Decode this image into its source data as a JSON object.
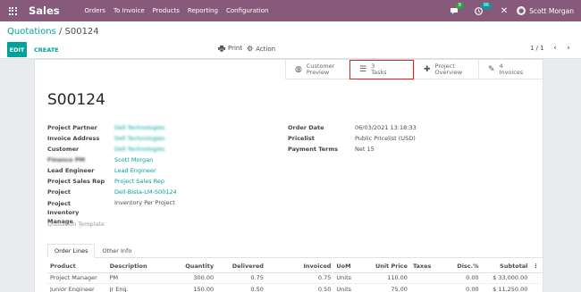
{
  "navbar": {
    "brand": "Sales",
    "menu": [
      "Orders",
      "To Invoice",
      "Products",
      "Reporting",
      "Configuration"
    ],
    "chat_badge": "8",
    "activity_badge": "96",
    "user_name": "Scott Morgan"
  },
  "control_panel": {
    "breadcrumb_parent": "Quotations",
    "breadcrumb_sep": "/",
    "breadcrumb_current": "S00124",
    "edit_label": "EDIT",
    "create_label": "CREATE",
    "print_label": "Print",
    "action_label": "Action",
    "pager": "1 / 1"
  },
  "smart_buttons": [
    {
      "icon": "globe-icon",
      "line1": "Customer",
      "line2": "Preview"
    },
    {
      "icon": "tasks-icon",
      "line1": "3",
      "line2": "Tasks"
    },
    {
      "icon": "puzzle-icon",
      "line1": "Project",
      "line2": "Overview"
    },
    {
      "icon": "edit-icon",
      "line1": "4",
      "line2": "Invoices"
    }
  ],
  "record": {
    "name": "S00124",
    "left_fields": [
      {
        "label": "Project Partner",
        "value": "Dell Technologies",
        "link": true,
        "blur": true
      },
      {
        "label": "Invoice Address",
        "value": "Dell Technologies",
        "link": true,
        "blur": true
      },
      {
        "label": "Customer",
        "value": "Dell Technologies",
        "link": true,
        "blur": true
      },
      {
        "label": "Finance PM",
        "value": "Scott Morgan",
        "link": true,
        "blur_label": true
      },
      {
        "label": "Lead Engineer",
        "value": "Lead Engineer",
        "link": true
      },
      {
        "label": "Project Sales Rep",
        "value": "Project Sales Rep",
        "link": true
      },
      {
        "label": "Project",
        "value": "Dell-Bista-LM-S00124",
        "link": true
      },
      {
        "label": "Project Inventory Manage",
        "value": "Inventory Per Project",
        "link": false
      }
    ],
    "quotation_template_label": "Quotation Template",
    "right_fields": [
      {
        "label": "Order Date",
        "value": "06/03/2021 13:18:33"
      },
      {
        "label": "Pricelist",
        "value": "Public Pricelist (USD)"
      },
      {
        "label": "Payment Terms",
        "value": "Net 15"
      }
    ]
  },
  "tabs": [
    "Order Lines",
    "Other Info"
  ],
  "order_lines": {
    "headers": [
      "Product",
      "Description",
      "Quantity",
      "Delivered",
      "Invoiced",
      "UoM",
      "Unit Price",
      "Taxes",
      "Disc.%",
      "Subtotal"
    ],
    "rows": [
      [
        "Project Manager",
        "PM",
        "300.00",
        "0.75",
        "0.75",
        "Units",
        "110.00",
        "",
        "0.00",
        "$ 33,000.00"
      ],
      [
        "Junior Engineer",
        "Jr Eng.",
        "150.00",
        "0.50",
        "0.50",
        "Units",
        "75.00",
        "",
        "0.00",
        "$ 11,250.00"
      ]
    ]
  }
}
